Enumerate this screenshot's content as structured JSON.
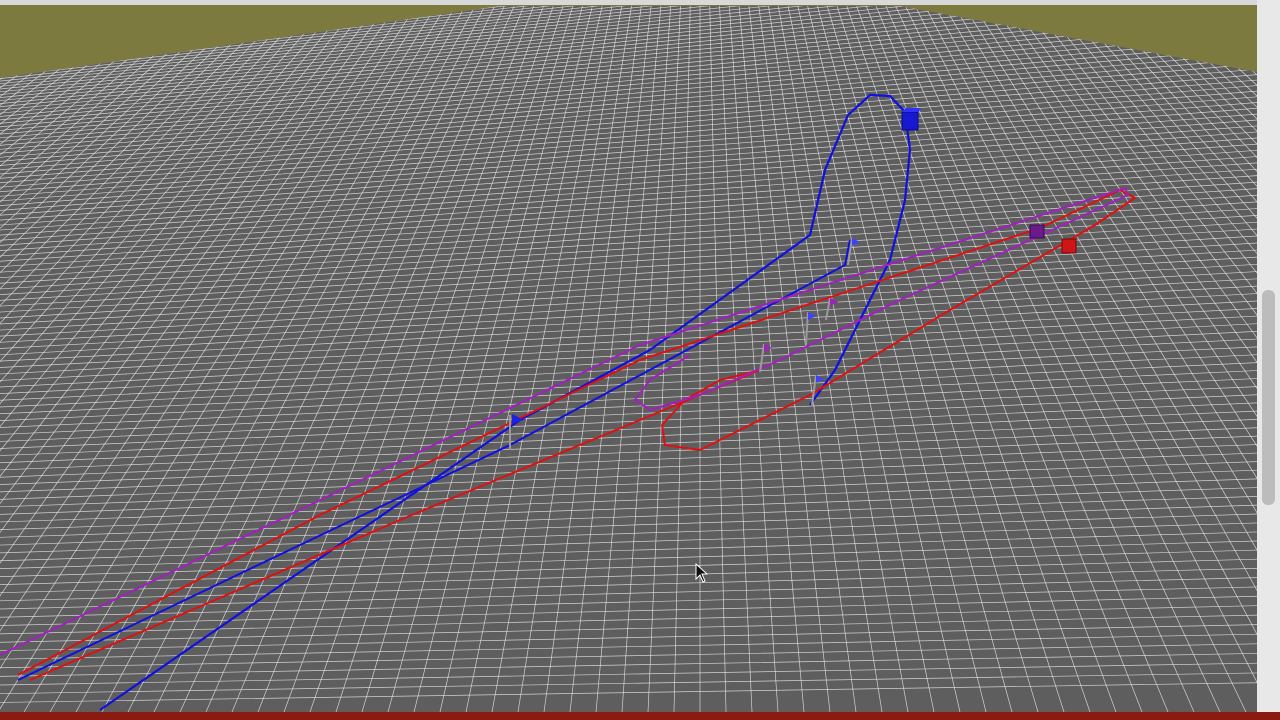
{
  "colors": {
    "sky": "#7d7a40",
    "ground": "#5e5e5e",
    "grid": "#e6e6e6",
    "trajectory_blue": "#1010e0",
    "trajectory_red": "#e01010",
    "trajectory_purple": "#a020c0",
    "frame": "#7a1208",
    "taskbar": "#8b1a10"
  },
  "icons": {
    "cursor": "mouse-pointer-icon"
  },
  "objects": {
    "blue_vehicle": "blue-vehicle-cube",
    "red_vehicle": "red-vehicle-cube",
    "purple_vehicle": "purple-vehicle-cube"
  }
}
